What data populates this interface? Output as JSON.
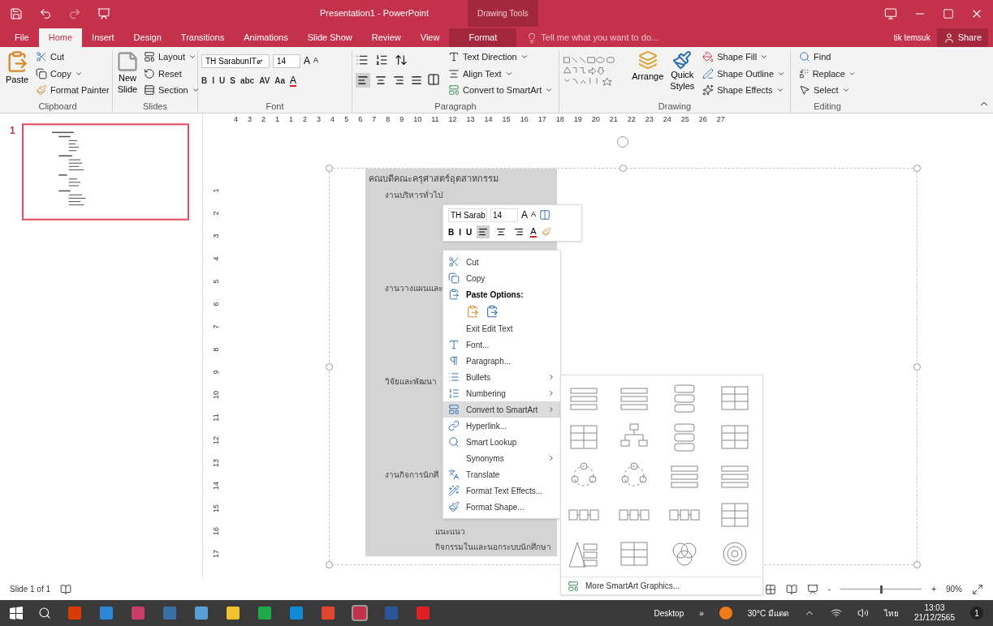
{
  "title_bar": {
    "title": "Presentation1 - PowerPoint",
    "context_label": "Drawing Tools"
  },
  "tabs": [
    {
      "label": "File",
      "selected": false
    },
    {
      "label": "Home",
      "selected": true
    },
    {
      "label": "Insert",
      "selected": false
    },
    {
      "label": "Design",
      "selected": false
    },
    {
      "label": "Transitions",
      "selected": false
    },
    {
      "label": "Animations",
      "selected": false
    },
    {
      "label": "Slide Show",
      "selected": false
    },
    {
      "label": "Review",
      "selected": false
    },
    {
      "label": "View",
      "selected": false
    },
    {
      "label": "Format",
      "selected": false,
      "kind": "contextual"
    }
  ],
  "tell_me": {
    "placeholder": "Tell me what you want to do..."
  },
  "user": "tik temsuk",
  "share": "Share",
  "clipboard": {
    "label": "Clipboard",
    "paste": "Paste",
    "cut": "Cut",
    "copy": "Copy",
    "format_painter": "Format Painter"
  },
  "slides": {
    "label": "Slides",
    "new_slide": "New Slide",
    "layout": "Layout",
    "reset": "Reset",
    "section": "Section"
  },
  "font": {
    "label": "Font",
    "font_name": "TH SarabunIT๙",
    "size": "14",
    "grow": "A",
    "shrink": "A",
    "formats": [
      "B",
      "I",
      "U",
      "S",
      "abc",
      "AV",
      "Aa"
    ],
    "font_color": "A"
  },
  "paragraph": {
    "label": "Paragraph",
    "text_direction": "Text Direction",
    "align_text": "Align Text",
    "convert": "Convert to SmartArt",
    "alignments": [
      {
        "selected": true
      },
      {
        "selected": false
      },
      {
        "selected": false
      },
      {
        "selected": false
      }
    ]
  },
  "drawing": {
    "label": "Drawing",
    "arrange": "Arrange",
    "quick_styles": "Quick Styles",
    "shape_fill": "Shape Fill",
    "shape_outline": "Shape Outline",
    "shape_effects": "Shape Effects"
  },
  "editing": {
    "label": "Editing",
    "find": "Find",
    "replace": "Replace",
    "select": "Select"
  },
  "thumbnails": [
    {
      "number": "1",
      "selected": true
    }
  ],
  "ruler": {
    "horizontal": [
      "4",
      "3",
      "2",
      "1",
      "1",
      "2",
      "3",
      "4",
      "5",
      "6",
      "7",
      "8",
      "9",
      "10",
      "11",
      "12",
      "13",
      "14",
      "15",
      "16",
      "17",
      "18",
      "19",
      "20",
      "21",
      "22",
      "23",
      "24",
      "25",
      "26",
      "27"
    ],
    "vertical": [
      "1",
      "2",
      "3",
      "4",
      "5",
      "6",
      "7",
      "8",
      "9",
      "10",
      "11",
      "12",
      "13",
      "14",
      "15",
      "16",
      "17"
    ]
  },
  "slide_text": {
    "title": "คณบดีคณะครุศาสตร์อุตสาหกรรม",
    "children": [
      {
        "text": "งานบริหารทั่วไป"
      },
      {
        "text": "งานวางแผนและ"
      },
      {
        "text": "วิจัยและพัฒนา"
      },
      {
        "text": "งานกิจการนักศึ",
        "children": [
          {
            "text": "แนะแนว"
          },
          {
            "text": "กิจกรรมในและนอกระบบนักศึกษา"
          }
        ]
      }
    ]
  },
  "mini_toolbar": {
    "font_name": "TH Sarab",
    "size": "14",
    "grow": "A",
    "shrink": "A",
    "formats": [
      "B",
      "I",
      "U"
    ],
    "alignments": [
      {
        "selected": true
      },
      {
        "selected": false
      },
      {
        "selected": false
      }
    ],
    "font_color": "A"
  },
  "context_menu": [
    {
      "kind": "item",
      "label": "Cut"
    },
    {
      "kind": "item",
      "label": "Copy"
    },
    {
      "kind": "header",
      "label": "Paste Options:"
    },
    {
      "kind": "paste_icons"
    },
    {
      "kind": "item",
      "label": "Exit Edit Text"
    },
    {
      "kind": "item",
      "label": "Font..."
    },
    {
      "kind": "item",
      "label": "Paragraph..."
    },
    {
      "kind": "submenu",
      "label": "Bullets",
      "selected": false
    },
    {
      "kind": "submenu",
      "label": "Numbering",
      "selected": false
    },
    {
      "kind": "submenu",
      "label": "Convert to SmartArt",
      "selected": true
    },
    {
      "kind": "item",
      "label": "Hyperlink..."
    },
    {
      "kind": "item",
      "label": "Smart Lookup"
    },
    {
      "kind": "submenu",
      "label": "Synonyms",
      "selected": false
    },
    {
      "kind": "item",
      "label": "Translate"
    },
    {
      "kind": "item",
      "label": "Format Text Effects..."
    },
    {
      "kind": "item",
      "label": "Format Shape..."
    }
  ],
  "smartart_gallery": {
    "layouts": [
      {
        "kind": "list"
      },
      {
        "kind": "list"
      },
      {
        "kind": "stack"
      },
      {
        "kind": "table"
      },
      {
        "kind": "table"
      },
      {
        "kind": "hierarchy"
      },
      {
        "kind": "stack"
      },
      {
        "kind": "table"
      },
      {
        "kind": "cycle"
      },
      {
        "kind": "cycle"
      },
      {
        "kind": "list"
      },
      {
        "kind": "list"
      },
      {
        "kind": "process"
      },
      {
        "kind": "process"
      },
      {
        "kind": "process"
      },
      {
        "kind": "table"
      },
      {
        "kind": "pyramid"
      },
      {
        "kind": "table"
      },
      {
        "kind": "venn"
      },
      {
        "kind": "target"
      }
    ],
    "more": "More SmartArt Graphics..."
  },
  "status_bar": {
    "slide_info": "Slide 1 of 1",
    "zoom_out": "-",
    "zoom_in": "+",
    "zoom": "90%",
    "level": 0.5
  },
  "taskbar": {
    "apps": [
      {
        "color": "#d83b01",
        "selected": false
      },
      {
        "color": "#2b88d8",
        "selected": false
      },
      {
        "color": "#c83e6a",
        "selected": false
      },
      {
        "color": "#3a6ea5",
        "selected": false
      },
      {
        "color": "#5aa0d8",
        "selected": false
      },
      {
        "color": "#f2c12e",
        "selected": false
      },
      {
        "color": "#1faa48",
        "selected": false
      },
      {
        "color": "#0f8bd6",
        "selected": false
      },
      {
        "color": "#e0452f",
        "selected": false
      },
      {
        "color": "#c4314b",
        "selected": true
      },
      {
        "color": "#2b579a",
        "selected": false
      },
      {
        "color": "#e02020",
        "selected": false
      }
    ],
    "desktop": "Desktop",
    "chevron": "»",
    "weather": "30°C มีแดด",
    "language": "ไทย",
    "time": "13:03",
    "date": "21/12/2565",
    "notifications": "1"
  }
}
